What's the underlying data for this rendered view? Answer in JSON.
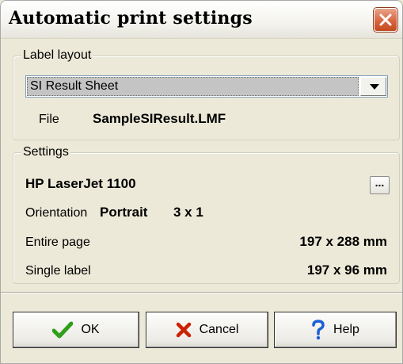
{
  "window": {
    "title": "Automatic print settings",
    "close_icon": "close-x-icon",
    "close_color": "#d8643f"
  },
  "label_layout": {
    "legend": "Label layout",
    "layout_select": "SI Result Sheet",
    "file_label": "File",
    "file_value": "SampleSIResult.LMF"
  },
  "settings": {
    "legend": "Settings",
    "printer": "HP LaserJet 1100",
    "browse_label": "...",
    "orientation_label": "Orientation",
    "orientation_value": "Portrait",
    "grid": "3 x 1",
    "entire_page_label": "Entire page",
    "entire_page_value": "197 x 288 mm",
    "single_label_label": "Single label",
    "single_label_value": "197 x 96 mm"
  },
  "buttons": {
    "ok": "OK",
    "cancel": "Cancel",
    "help": "Help",
    "ok_icon": "checkmark-icon",
    "cancel_icon": "cross-icon",
    "help_icon": "question-mark-icon"
  }
}
